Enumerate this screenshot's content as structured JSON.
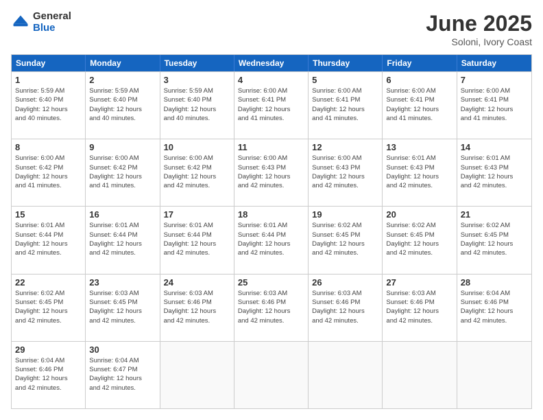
{
  "logo": {
    "general": "General",
    "blue": "Blue"
  },
  "title": "June 2025",
  "location": "Soloni, Ivory Coast",
  "days_of_week": [
    "Sunday",
    "Monday",
    "Tuesday",
    "Wednesday",
    "Thursday",
    "Friday",
    "Saturday"
  ],
  "weeks": [
    [
      {
        "day": 1,
        "sunrise": "5:59 AM",
        "sunset": "6:40 PM",
        "daylight": "12 hours and 40 minutes."
      },
      {
        "day": 2,
        "sunrise": "5:59 AM",
        "sunset": "6:40 PM",
        "daylight": "12 hours and 40 minutes."
      },
      {
        "day": 3,
        "sunrise": "5:59 AM",
        "sunset": "6:40 PM",
        "daylight": "12 hours and 40 minutes."
      },
      {
        "day": 4,
        "sunrise": "6:00 AM",
        "sunset": "6:41 PM",
        "daylight": "12 hours and 41 minutes."
      },
      {
        "day": 5,
        "sunrise": "6:00 AM",
        "sunset": "6:41 PM",
        "daylight": "12 hours and 41 minutes."
      },
      {
        "day": 6,
        "sunrise": "6:00 AM",
        "sunset": "6:41 PM",
        "daylight": "12 hours and 41 minutes."
      },
      {
        "day": 7,
        "sunrise": "6:00 AM",
        "sunset": "6:41 PM",
        "daylight": "12 hours and 41 minutes."
      }
    ],
    [
      {
        "day": 8,
        "sunrise": "6:00 AM",
        "sunset": "6:42 PM",
        "daylight": "12 hours and 41 minutes."
      },
      {
        "day": 9,
        "sunrise": "6:00 AM",
        "sunset": "6:42 PM",
        "daylight": "12 hours and 41 minutes."
      },
      {
        "day": 10,
        "sunrise": "6:00 AM",
        "sunset": "6:42 PM",
        "daylight": "12 hours and 42 minutes."
      },
      {
        "day": 11,
        "sunrise": "6:00 AM",
        "sunset": "6:43 PM",
        "daylight": "12 hours and 42 minutes."
      },
      {
        "day": 12,
        "sunrise": "6:00 AM",
        "sunset": "6:43 PM",
        "daylight": "12 hours and 42 minutes."
      },
      {
        "day": 13,
        "sunrise": "6:01 AM",
        "sunset": "6:43 PM",
        "daylight": "12 hours and 42 minutes."
      },
      {
        "day": 14,
        "sunrise": "6:01 AM",
        "sunset": "6:43 PM",
        "daylight": "12 hours and 42 minutes."
      }
    ],
    [
      {
        "day": 15,
        "sunrise": "6:01 AM",
        "sunset": "6:44 PM",
        "daylight": "12 hours and 42 minutes."
      },
      {
        "day": 16,
        "sunrise": "6:01 AM",
        "sunset": "6:44 PM",
        "daylight": "12 hours and 42 minutes."
      },
      {
        "day": 17,
        "sunrise": "6:01 AM",
        "sunset": "6:44 PM",
        "daylight": "12 hours and 42 minutes."
      },
      {
        "day": 18,
        "sunrise": "6:01 AM",
        "sunset": "6:44 PM",
        "daylight": "12 hours and 42 minutes."
      },
      {
        "day": 19,
        "sunrise": "6:02 AM",
        "sunset": "6:45 PM",
        "daylight": "12 hours and 42 minutes."
      },
      {
        "day": 20,
        "sunrise": "6:02 AM",
        "sunset": "6:45 PM",
        "daylight": "12 hours and 42 minutes."
      },
      {
        "day": 21,
        "sunrise": "6:02 AM",
        "sunset": "6:45 PM",
        "daylight": "12 hours and 42 minutes."
      }
    ],
    [
      {
        "day": 22,
        "sunrise": "6:02 AM",
        "sunset": "6:45 PM",
        "daylight": "12 hours and 42 minutes."
      },
      {
        "day": 23,
        "sunrise": "6:03 AM",
        "sunset": "6:45 PM",
        "daylight": "12 hours and 42 minutes."
      },
      {
        "day": 24,
        "sunrise": "6:03 AM",
        "sunset": "6:46 PM",
        "daylight": "12 hours and 42 minutes."
      },
      {
        "day": 25,
        "sunrise": "6:03 AM",
        "sunset": "6:46 PM",
        "daylight": "12 hours and 42 minutes."
      },
      {
        "day": 26,
        "sunrise": "6:03 AM",
        "sunset": "6:46 PM",
        "daylight": "12 hours and 42 minutes."
      },
      {
        "day": 27,
        "sunrise": "6:03 AM",
        "sunset": "6:46 PM",
        "daylight": "12 hours and 42 minutes."
      },
      {
        "day": 28,
        "sunrise": "6:04 AM",
        "sunset": "6:46 PM",
        "daylight": "12 hours and 42 minutes."
      }
    ],
    [
      {
        "day": 29,
        "sunrise": "6:04 AM",
        "sunset": "6:46 PM",
        "daylight": "12 hours and 42 minutes."
      },
      {
        "day": 30,
        "sunrise": "6:04 AM",
        "sunset": "6:47 PM",
        "daylight": "12 hours and 42 minutes."
      },
      null,
      null,
      null,
      null,
      null
    ]
  ]
}
